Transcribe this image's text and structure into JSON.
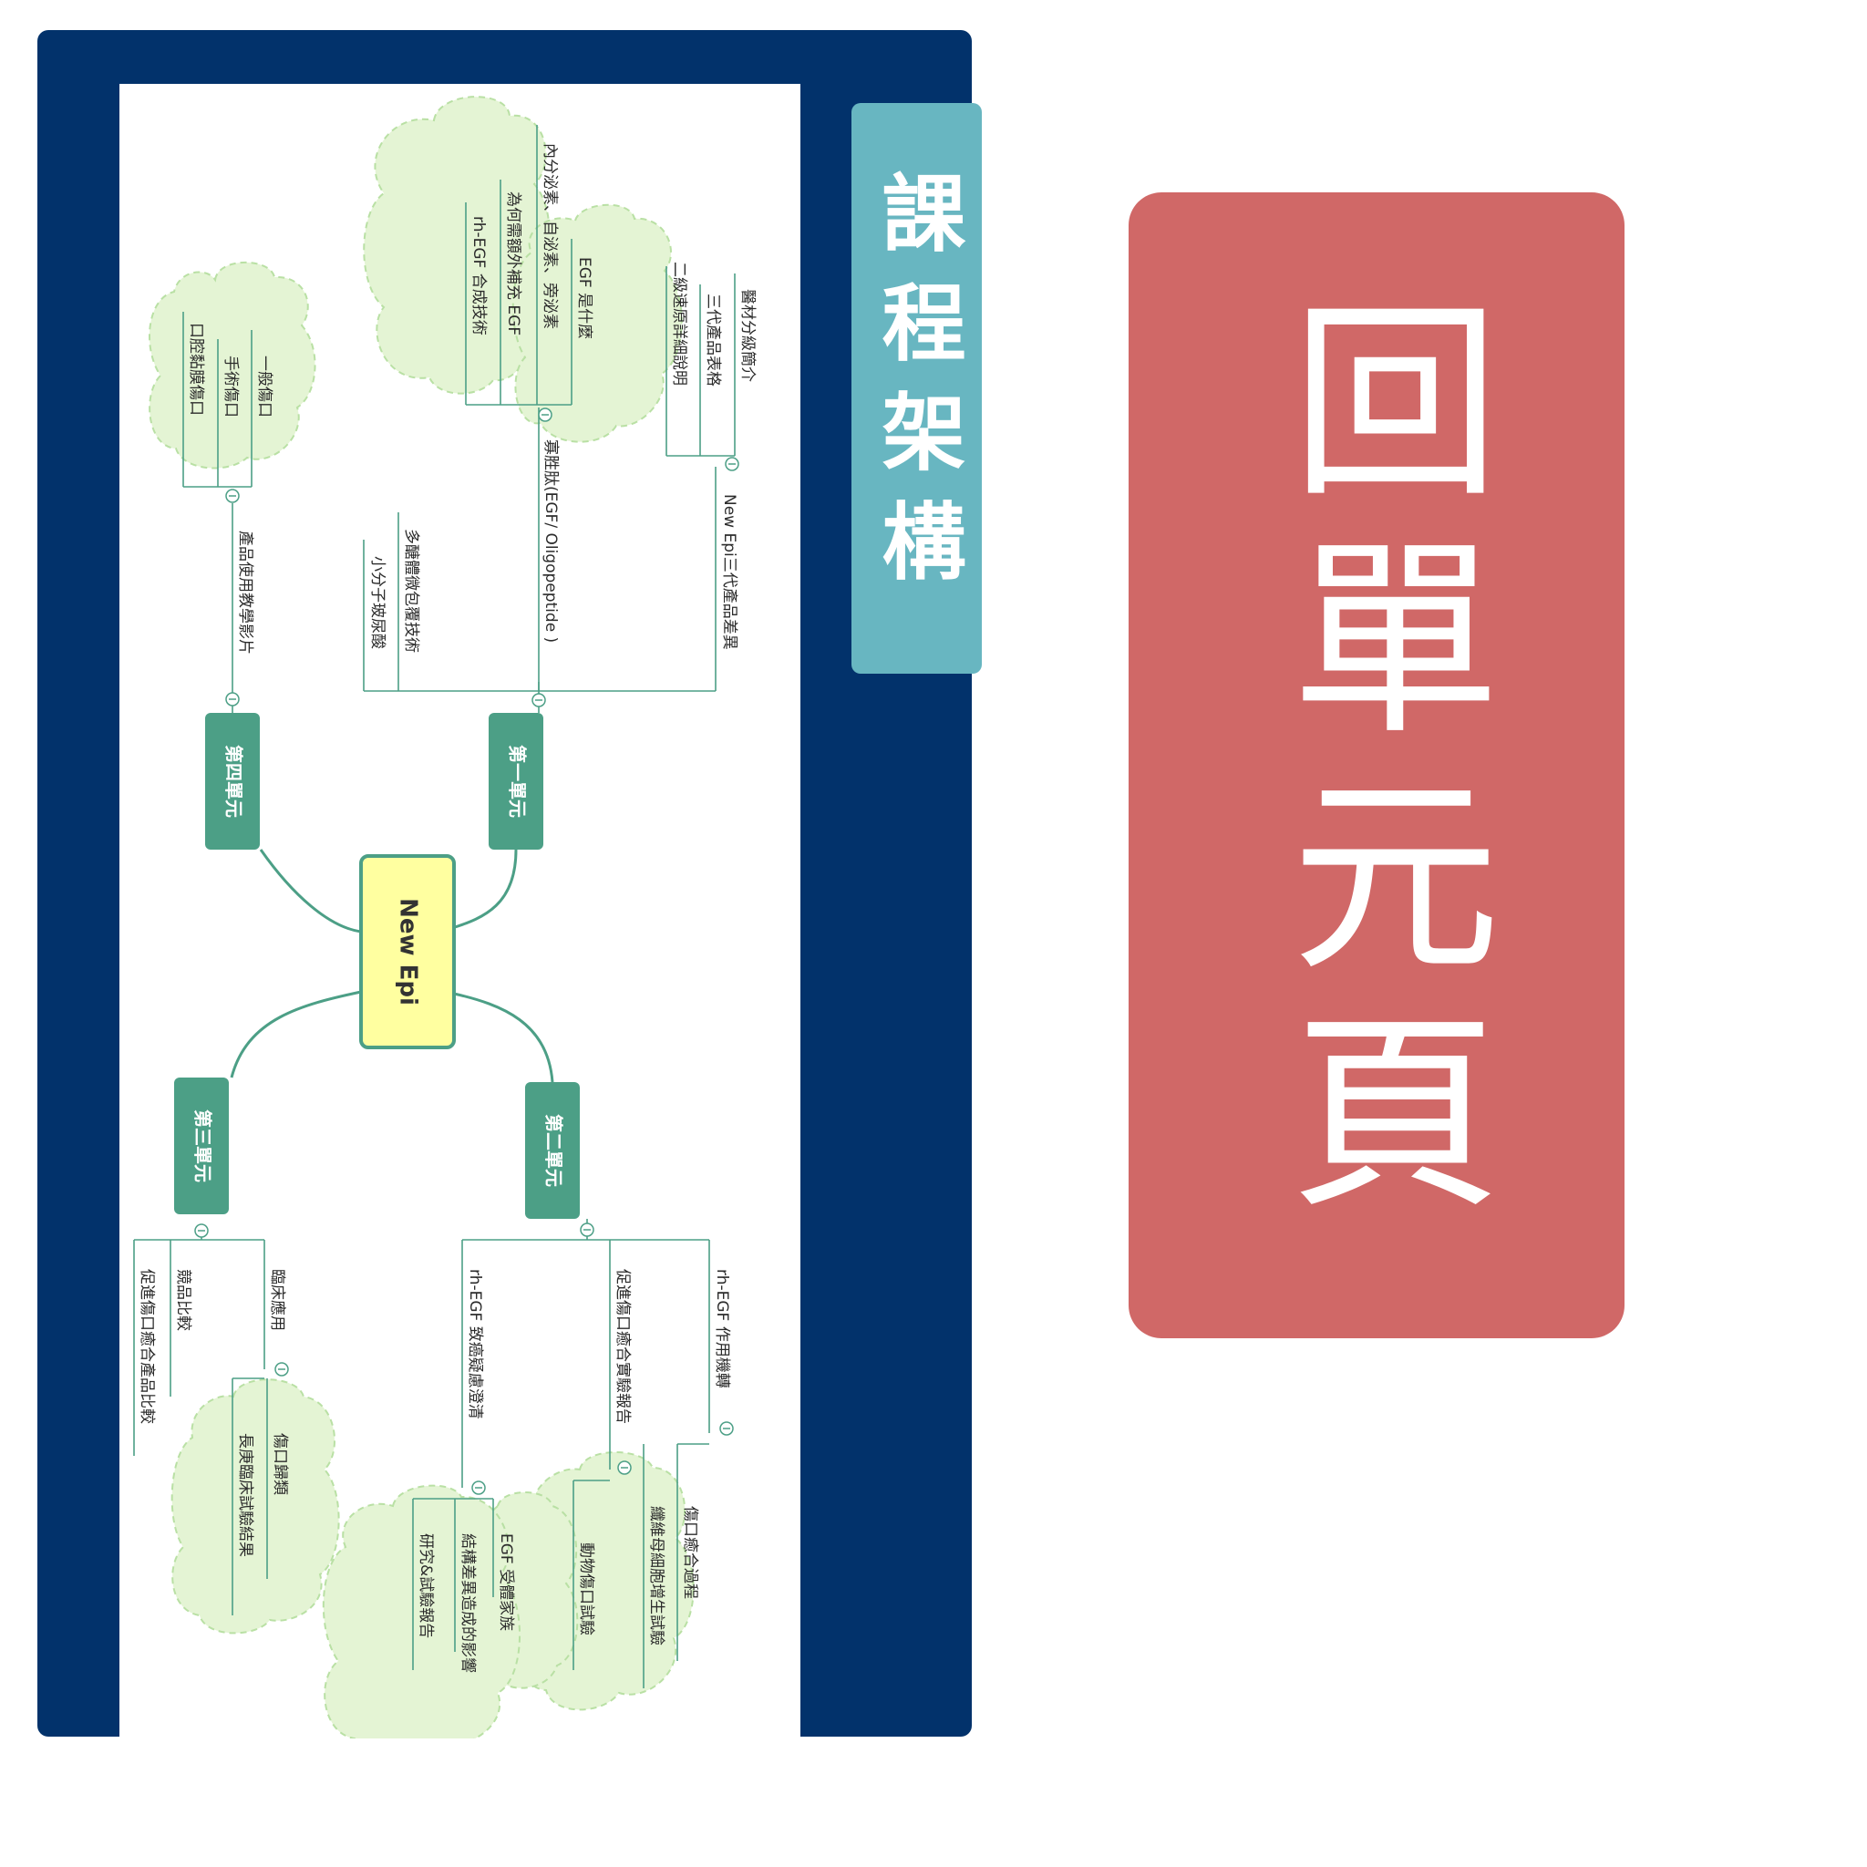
{
  "title": "課程架構",
  "home_button": "回單元頁",
  "mindmap": {
    "center": "New Epi",
    "units": {
      "unit1": {
        "label": "第一單元",
        "topics": {
          "t1": {
            "label": "New Epi三代產品差異",
            "items": [
              "醫材分級簡介",
              "三代產品表格",
              "二級速原詳細說明"
            ]
          },
          "t2": {
            "label": "寡胜肽(EGF/ Oligopeptide )",
            "items": [
              "EGF 是什麼",
              "內分泌素、自泌素、旁泌素",
              "為何需額外補充 EGF",
              "rh-EGF 合成技術"
            ]
          },
          "t3": {
            "label": "多醣體微包覆技術"
          },
          "t4": {
            "label": "小分子玻尿酸"
          }
        }
      },
      "unit4": {
        "label": "第四單元",
        "topics": {
          "t1": {
            "label": "產品使用教學影片",
            "items": [
              "一般傷口",
              "手術傷口",
              "口腔黏膜傷口"
            ]
          }
        }
      },
      "unit2": {
        "label": "第二單元",
        "topics": {
          "t1": {
            "label": "rh-EGF 作用機轉",
            "items": [
              "傷口癒合過程",
              "纖維母細胞增生試驗"
            ]
          },
          "t2": {
            "label": "促進傷口癒合實驗報告",
            "items": [
              "動物傷口試驗"
            ]
          },
          "t3": {
            "label": "rh-EGF 致癌疑慮澄清",
            "items": [
              "EGF 受體家族",
              "結構差異造成的影響",
              "研究&試驗報告"
            ]
          }
        }
      },
      "unit3": {
        "label": "第三單元",
        "topics": {
          "t1": {
            "label": "臨床應用",
            "items": [
              "傷口歸類",
              "長庚臨床試驗結果"
            ]
          },
          "t2": {
            "label": "競品比較"
          },
          "t3": {
            "label": "促進傷口癒合產品比較"
          }
        }
      }
    }
  },
  "colors": {
    "panel": "#02326b",
    "title_banner": "#68b6c1",
    "home_button": "#d06867",
    "unit_node": "#4c9f86",
    "center_fill": "#ffffa0",
    "cloud_fill": "#e4f4d4"
  }
}
